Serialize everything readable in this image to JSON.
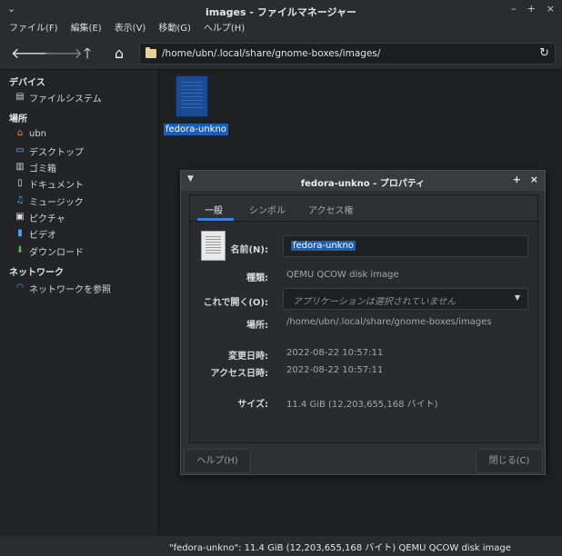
{
  "window": {
    "title": "images - ファイルマネージャー",
    "left_icon": "chevron-down-icon",
    "controls": [
      "–",
      "+",
      "×"
    ]
  },
  "menu": [
    "ファイル(F)",
    "編集(E)",
    "表示(V)",
    "移動(G)",
    "ヘルプ(H)"
  ],
  "toolbar": {
    "back": "🡐",
    "forward": "🡒",
    "up": "🡑",
    "home": "⌂",
    "path": "/home/ubn/.local/share/gnome-boxes/images/",
    "reload": "↻"
  },
  "sidebar": {
    "devices_header": "デバイス",
    "devices": [
      {
        "label": "ファイルシステム",
        "icon": "drive-icon",
        "glyph": "▤"
      }
    ],
    "places_header": "場所",
    "places": [
      {
        "label": "ubn",
        "icon": "home-icon",
        "glyph": "⌂"
      },
      {
        "label": "デスクトップ",
        "icon": "desktop-icon",
        "glyph": "▭"
      },
      {
        "label": "ゴミ箱",
        "icon": "trash-icon",
        "glyph": "▥"
      },
      {
        "label": "ドキュメント",
        "icon": "document-icon",
        "glyph": "▯"
      },
      {
        "label": "ミュージック",
        "icon": "music-icon",
        "glyph": "♫"
      },
      {
        "label": "ピクチャ",
        "icon": "picture-icon",
        "glyph": "▣"
      },
      {
        "label": "ビデオ",
        "icon": "video-icon",
        "glyph": "▮"
      },
      {
        "label": "ダウンロード",
        "icon": "download-icon",
        "glyph": "⬇"
      }
    ],
    "network_header": "ネットワーク",
    "network": [
      {
        "label": "ネットワークを参照",
        "icon": "network-icon",
        "glyph": "◠"
      }
    ]
  },
  "content": {
    "file_name": "fedora-unkno"
  },
  "status": "\"fedora-unkno\": 11.4 GiB (12,203,655,168 バイト) QEMU QCOW disk image",
  "dialog": {
    "title": "fedora-unkno - プロパティ",
    "title_left": "▼",
    "title_right": [
      "+",
      "×"
    ],
    "tabs": [
      "一般",
      "シンボル",
      "アクセス権"
    ],
    "name_label": "名前(N):",
    "name_value": "fedora-unkno",
    "type_label": "種類:",
    "type_value": "QEMU QCOW disk image",
    "open_with_label": "これで開く(O):",
    "open_with_value": "アプリケーションは選択されていません",
    "location_label": "場所:",
    "location_value": "/home/ubn/.local/share/gnome-boxes/images",
    "modified_label": "変更日時:",
    "modified_value": "2022-08-22 10:57:11",
    "accessed_label": "アクセス日時:",
    "accessed_value": "2022-08-22 10:57:11",
    "size_label": "サイズ:",
    "size_value": "11.4 GiB (12,203,655,168 バイト)",
    "help_button": "ヘルプ(H)",
    "close_button": "閉じる(C)"
  },
  "colors": {
    "accent": "#1c5fb8",
    "home_icon": "#f08a3c",
    "music_icon": "#4aa3ff",
    "download_icon": "#5fbf4a",
    "network_icon": "#4aa3ff"
  }
}
